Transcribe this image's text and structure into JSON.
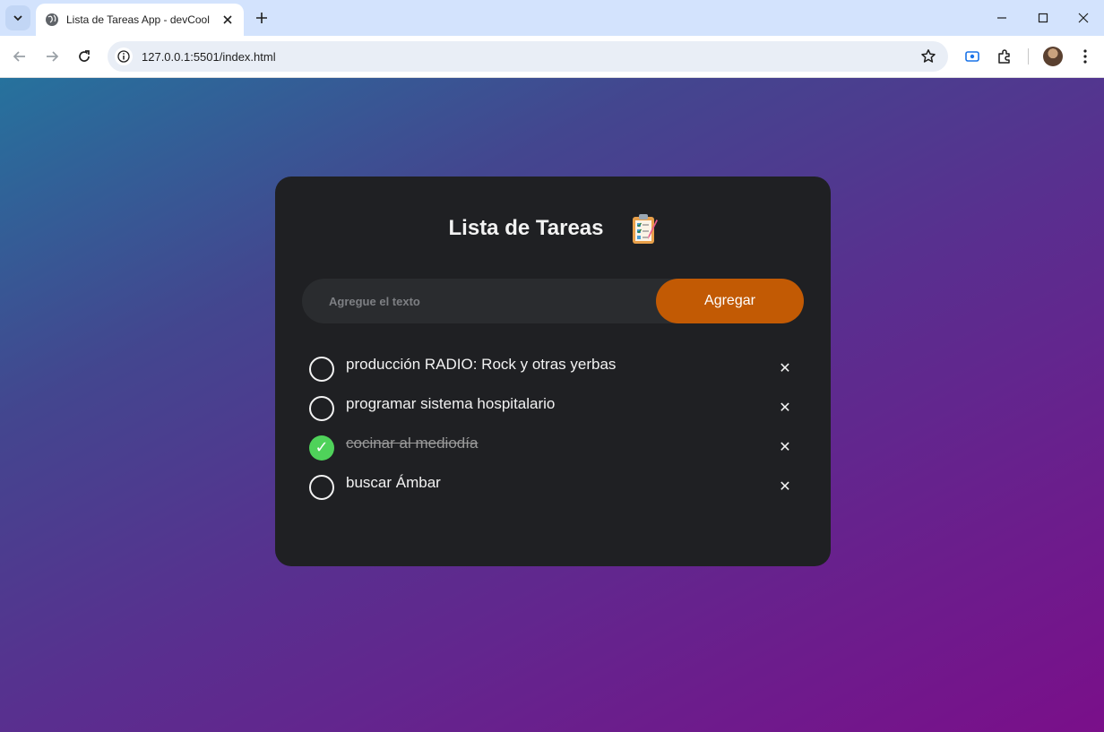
{
  "browser": {
    "tab_title": "Lista de Tareas App - devCool",
    "url": "127.0.0.1:5501/index.html",
    "icons": {
      "tab_search": "chevron-down-icon",
      "favicon": "globe-icon",
      "tab_close": "close-icon",
      "new_tab": "plus-icon",
      "minimize": "minimize-icon",
      "maximize": "maximize-icon",
      "close_window": "close-icon",
      "back": "back-arrow-icon",
      "forward": "forward-arrow-icon",
      "reload": "reload-icon",
      "site_info": "info-icon",
      "bookmark": "star-icon",
      "screen_cast": "cast-icon",
      "extensions": "puzzle-icon",
      "profile": "avatar",
      "menu": "kebab-menu-icon"
    }
  },
  "app": {
    "title": "Lista de Tareas",
    "title_icon": "clipboard-checklist-icon",
    "input_placeholder": "Agregue el texto",
    "input_value": "",
    "add_label": "Agregar",
    "tasks": [
      {
        "text": "producción RADIO: Rock y otras yerbas",
        "done": false
      },
      {
        "text": "programar sistema hospitalario",
        "done": false
      },
      {
        "text": "cocinar al mediodía",
        "done": true
      },
      {
        "text": "buscar Ámbar",
        "done": false
      }
    ],
    "delete_symbol": "✕"
  },
  "colors": {
    "card_bg": "#1f2023",
    "accent": "#c25a04",
    "done_green": "#4fd25a",
    "gradient_start": "#26729d",
    "gradient_end": "#7a0f8a"
  }
}
